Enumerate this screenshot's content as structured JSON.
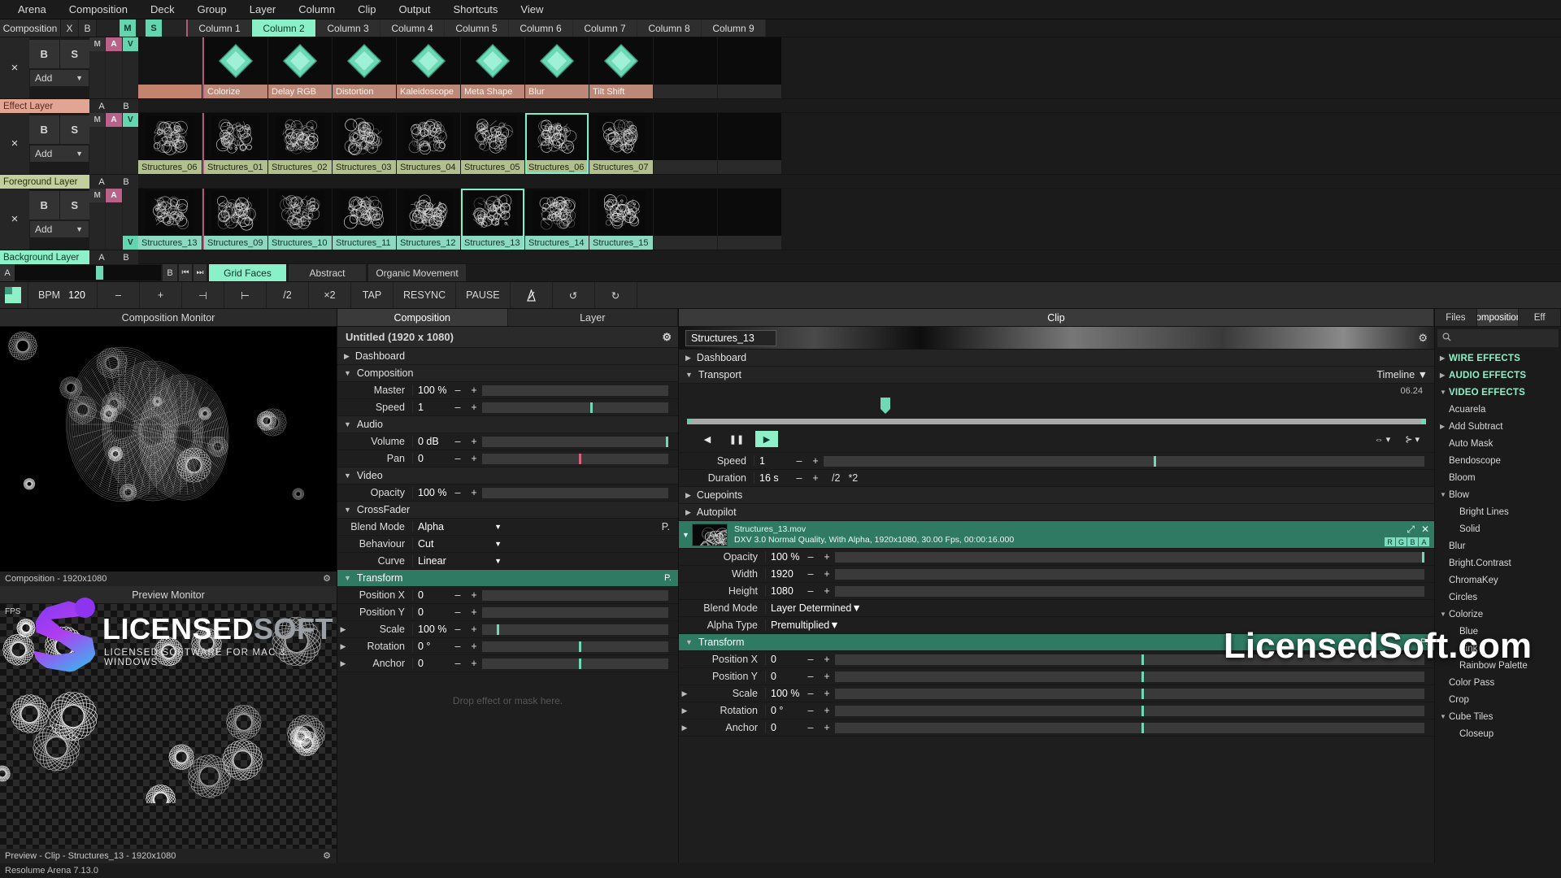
{
  "menubar": [
    "Arena",
    "Composition",
    "Deck",
    "Group",
    "Layer",
    "Column",
    "Clip",
    "Output",
    "Shortcuts",
    "View"
  ],
  "deck": {
    "tab_label": "Composition",
    "close": "X",
    "b": "B",
    "m": "M",
    "s": "S",
    "columns": [
      "Column 1",
      "Column 2",
      "Column 3",
      "Column 4",
      "Column 5",
      "Column 6",
      "Column 7",
      "Column 8",
      "Column 9"
    ],
    "selected_column": "Column 2"
  },
  "layer_controls": {
    "close": "×",
    "b": "B",
    "s": "S",
    "add": "Add",
    "caret": "▼",
    "m": "M",
    "a": "A",
    "v": "V",
    "col_a": "A",
    "col_b": "B"
  },
  "layers": [
    {
      "name": "Effect Layer",
      "type": "effect",
      "active_index": -1,
      "clips": [
        "Colorize",
        "Delay RGB",
        "Distortion",
        "Kaleidoscope",
        "Meta Shape",
        "Blur",
        "Tilt Shift",
        "",
        ""
      ],
      "preview_clip": ""
    },
    {
      "name": "Foreground Layer",
      "type": "foreground",
      "active_index": 5,
      "clips": [
        "Structures_01",
        "Structures_02",
        "Structures_03",
        "Structures_04",
        "Structures_05",
        "Structures_06",
        "Structures_07",
        "",
        ""
      ],
      "preview_clip": "Structures_06"
    },
    {
      "name": "Background Layer",
      "type": "background",
      "active_index": 4,
      "clips": [
        "Structures_09",
        "Structures_10",
        "Structures_11",
        "Structures_12",
        "Structures_13",
        "Structures_14",
        "Structures_15",
        "",
        ""
      ],
      "preview_clip": "Structures_13"
    }
  ],
  "crossfader": {
    "a": "A",
    "b": "B",
    "prev_icon": "⏮",
    "next_icon": "⏭",
    "presets": [
      "Grid Faces",
      "Abstract",
      "Organic Movement"
    ],
    "selected_preset": "Grid Faces"
  },
  "bpm_bar": {
    "bpm_label": "BPM",
    "bpm_value": "120",
    "minus": "–",
    "plus": "+",
    "nudge_left": "⊣",
    "nudge_right": "⊢",
    "half": "/2",
    "double": "×2",
    "tap": "TAP",
    "resync": "RESYNC",
    "pause": "PAUSE",
    "metronome_icon": "metronome-icon",
    "undo_icon": "↺",
    "redo_icon": "↻"
  },
  "composition_monitor": {
    "title": "Composition Monitor",
    "footer": "Composition - 1920x1080",
    "gear": "⚙"
  },
  "preview_monitor": {
    "title": "Preview Monitor",
    "fps": "FPS",
    "footer": "Preview - Clip - Structures_13 - 1920x1080",
    "gear": "⚙"
  },
  "comp_panel": {
    "tabs": [
      "Composition",
      "Layer"
    ],
    "selected_tab": "Composition",
    "title": "Untitled (1920 x 1080)",
    "gear": "⚙",
    "groups": [
      {
        "label": "Dashboard",
        "open": false,
        "rows": []
      },
      {
        "label": "Composition",
        "open": true,
        "rows": [
          {
            "label": "Master",
            "value": "100 %",
            "minus": "–",
            "plus": "+",
            "fill": "none"
          },
          {
            "label": "Speed",
            "value": "1",
            "minus": "–",
            "plus": "+",
            "fill": "mid"
          }
        ]
      },
      {
        "label": "Audio",
        "open": true,
        "rows": [
          {
            "label": "Volume",
            "value": "0 dB",
            "minus": "–",
            "plus": "+",
            "fill": "end"
          },
          {
            "label": "Pan",
            "value": "0",
            "minus": "–",
            "plus": "+",
            "fill": "center-pink"
          }
        ]
      },
      {
        "label": "Video",
        "open": true,
        "rows": [
          {
            "label": "Opacity",
            "value": "100 %",
            "minus": "–",
            "plus": "+",
            "fill": "none"
          }
        ]
      },
      {
        "label": "CrossFader",
        "open": true,
        "rows": [
          {
            "label": "Blend Mode",
            "dropdown": "Alpha",
            "caret": "▼",
            "right": "P."
          },
          {
            "label": "Behaviour",
            "dropdown": "Cut",
            "caret": "▼"
          },
          {
            "label": "Curve",
            "dropdown": "Linear",
            "caret": "▼"
          }
        ]
      },
      {
        "label": "Transform",
        "open": true,
        "accent": true,
        "badge": "P.",
        "rows": [
          {
            "label": "Position X",
            "value": "0",
            "minus": "–",
            "plus": "+"
          },
          {
            "label": "Position Y",
            "value": "0",
            "minus": "–",
            "plus": "+"
          },
          {
            "label": "Scale",
            "value": "100 %",
            "minus": "–",
            "plus": "+",
            "expand": "▶",
            "fill": "low"
          },
          {
            "label": "Rotation",
            "value": "0 °",
            "minus": "–",
            "plus": "+",
            "expand": "▶",
            "fill": "center"
          },
          {
            "label": "Anchor",
            "value": "0",
            "minus": "–",
            "plus": "+",
            "expand": "▶",
            "fill": "center"
          }
        ]
      }
    ],
    "drop_hint": "Drop effect or mask here."
  },
  "clip_panel": {
    "tab": "Clip",
    "clip_name": "Structures_13",
    "gear": "⚙",
    "dashboard": "Dashboard",
    "transport": "Transport",
    "transport_mode": "Timeline",
    "transport_caret": "▼",
    "time_display": "06.24",
    "buttons": {
      "reverse": "◀",
      "pause": "❚❚",
      "play": "▶",
      "bounce": "⇔",
      "cue": "⊱"
    },
    "rows": [
      {
        "label": "Speed",
        "value": "1",
        "minus": "–",
        "plus": "+"
      },
      {
        "label": "Duration",
        "value": "16 s",
        "minus": "–",
        "plus": "+",
        "half": "/2",
        "double": "*2"
      }
    ],
    "cuepoints": "Cuepoints",
    "autopilot": "Autopilot",
    "media": {
      "filename": "Structures_13.mov",
      "details": "DXV 3.0 Normal Quality, With Alpha, 1920x1080, 30.00 Fps, 00:00:16.000",
      "expand_icon": "⤢",
      "close_icon": "✕",
      "channels": [
        "R",
        "G",
        "B",
        "A"
      ]
    },
    "media_rows": [
      {
        "label": "Opacity",
        "value": "100 %",
        "minus": "–",
        "plus": "+"
      },
      {
        "label": "Width",
        "value": "1920",
        "minus": "–",
        "plus": "+"
      },
      {
        "label": "Height",
        "value": "1080",
        "minus": "–",
        "plus": "+"
      },
      {
        "label": "Blend Mode",
        "dropdown": "Layer Determined",
        "caret": "▼"
      },
      {
        "label": "Alpha Type",
        "dropdown": "Premultiplied",
        "caret": "▼"
      }
    ],
    "transform_group": {
      "label": "Transform",
      "badge": "P."
    },
    "transform_rows": [
      {
        "label": "Position X",
        "value": "0",
        "minus": "–",
        "plus": "+"
      },
      {
        "label": "Position Y",
        "value": "0",
        "minus": "–",
        "plus": "+"
      },
      {
        "label": "Scale",
        "value": "100 %",
        "minus": "–",
        "plus": "+",
        "expand": "▶"
      },
      {
        "label": "Rotation",
        "value": "0 °",
        "minus": "–",
        "plus": "+",
        "expand": "▶"
      },
      {
        "label": "Anchor",
        "value": "0",
        "minus": "–",
        "plus": "+",
        "expand": "▶"
      }
    ]
  },
  "right_panel": {
    "tabs": [
      "Files",
      "Compositions",
      "Eff"
    ],
    "selected_tab": "Compositions",
    "search_icon": "🔍",
    "search_placeholder": "",
    "items": [
      {
        "label": "WIRE EFFECTS",
        "kind": "cat",
        "tri": "▶"
      },
      {
        "label": "AUDIO EFFECTS",
        "kind": "cat",
        "tri": "▶"
      },
      {
        "label": "VIDEO EFFECTS",
        "kind": "cat",
        "tri": "▼"
      },
      {
        "label": "Acuarela",
        "kind": "item"
      },
      {
        "label": "Add Subtract",
        "kind": "item",
        "tri": "▶"
      },
      {
        "label": "Auto Mask",
        "kind": "item"
      },
      {
        "label": "Bendoscope",
        "kind": "item"
      },
      {
        "label": "Bloom",
        "kind": "item"
      },
      {
        "label": "Blow",
        "kind": "item",
        "tri": "▼"
      },
      {
        "label": "Bright Lines",
        "kind": "sub"
      },
      {
        "label": "Solid",
        "kind": "sub"
      },
      {
        "label": "Blur",
        "kind": "item"
      },
      {
        "label": "Bright.Contrast",
        "kind": "item"
      },
      {
        "label": "ChromaKey",
        "kind": "item"
      },
      {
        "label": "Circles",
        "kind": "item"
      },
      {
        "label": "Colorize",
        "kind": "item",
        "tri": "▼"
      },
      {
        "label": "Blue",
        "kind": "sub"
      },
      {
        "label": "Pink",
        "kind": "sub"
      },
      {
        "label": "Rainbow Palette",
        "kind": "sub"
      },
      {
        "label": "Color Pass",
        "kind": "item"
      },
      {
        "label": "Crop",
        "kind": "item"
      },
      {
        "label": "Cube Tiles",
        "kind": "item",
        "tri": "▼"
      },
      {
        "label": "Closeup",
        "kind": "sub"
      }
    ]
  },
  "status_bar": {
    "text": "Resolume Arena 7.13.0"
  },
  "watermark": {
    "logo_title_a": "LICENSED",
    "logo_title_b": "SOFT",
    "logo_subtitle": "LICENSED SOFTWARE FOR MAC & WINDOWS",
    "site": "LicensedSoft.com"
  },
  "colors": {
    "accent": "#8df0c8",
    "effect_layer": "#e1a693",
    "foreground_layer": "#c4cf9e",
    "background_layer": "#8df0c8",
    "clip_effect": "#bc8878",
    "clip_foreground": "#b2bf8e",
    "clip_background": "#8dd8c0",
    "audio_pink": "#b8628a",
    "panel_bg": "#1e1e1e"
  }
}
